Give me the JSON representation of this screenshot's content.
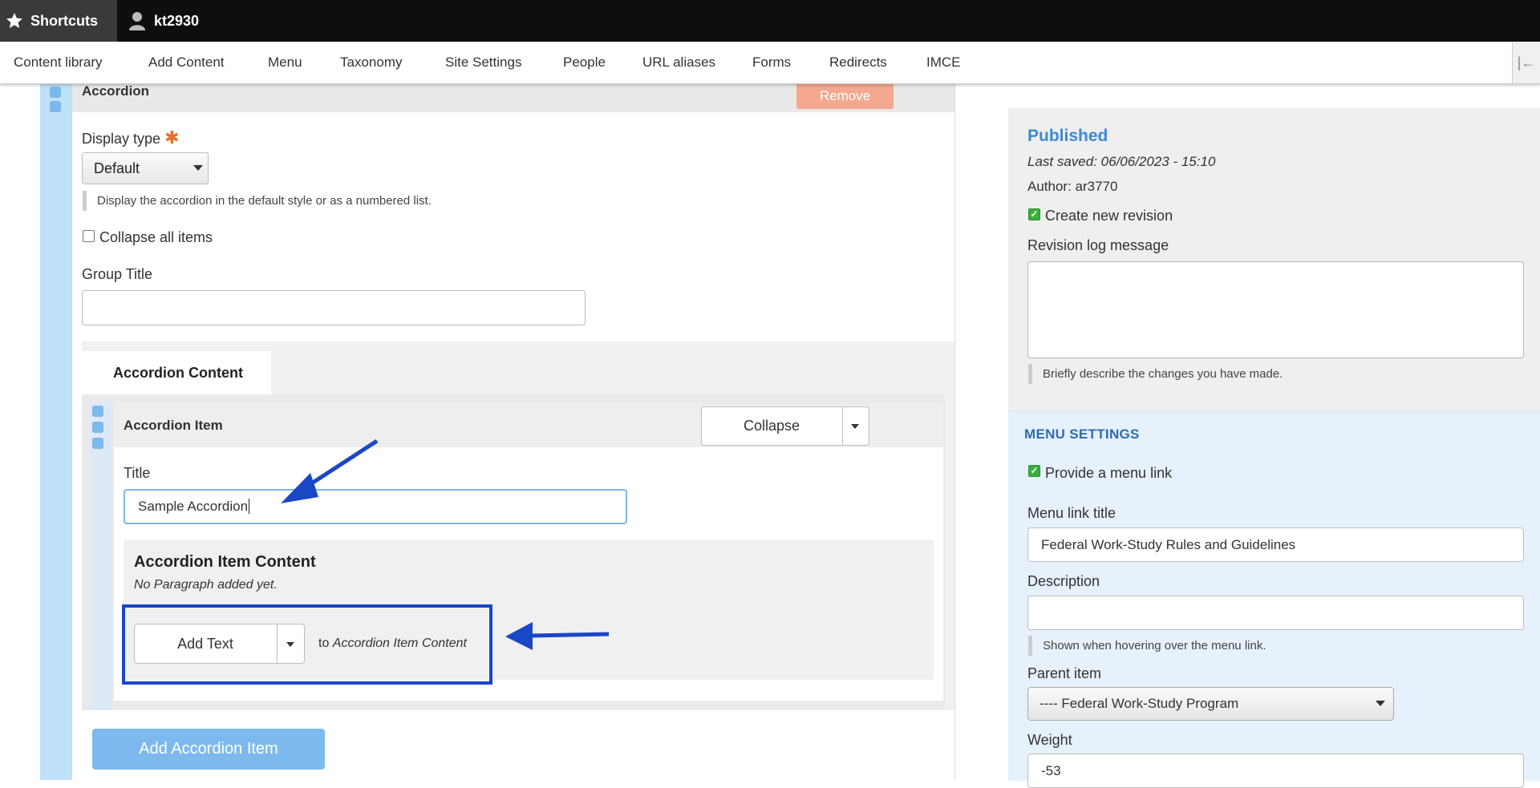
{
  "toolbar": {
    "shortcuts": "Shortcuts",
    "user": "kt2930"
  },
  "tray": {
    "items": [
      "Content library",
      "Add Content",
      "Menu",
      "Taxonomy",
      "Site Settings",
      "People",
      "URL aliases",
      "Forms",
      "Redirects",
      "IMCE"
    ]
  },
  "paragraph": {
    "title": "Accordion",
    "remove_label": "Remove",
    "display_type_label": "Display type",
    "display_type_value": "Default",
    "display_type_help": "Display the accordion in the default style or as a numbered list.",
    "collapse_all_label": "Collapse all items",
    "group_title_label": "Group Title",
    "group_title_value": "",
    "content_tab": "Accordion Content"
  },
  "accordion_item": {
    "title": "Accordion Item",
    "collapse_label": "Collapse",
    "title_label": "Title",
    "title_value": "Sample Accordion",
    "content_heading": "Accordion Item Content",
    "no_paragraph": "No Paragraph added yet.",
    "add_text_label": "Add Text",
    "to_prefix": "to",
    "to_target": "Accordion Item Content"
  },
  "add_accordion_item": "Add Accordion Item",
  "meta": {
    "status": "Published",
    "last_saved": "Last saved: 06/06/2023 - 15:10",
    "author": "Author: ar3770",
    "create_revision_label": "Create new revision",
    "create_revision_checked": true,
    "revision_log_label": "Revision log message",
    "revision_log_value": "",
    "revision_log_help": "Briefly describe the changes you have made."
  },
  "menu": {
    "heading": "MENU SETTINGS",
    "provide_link_label": "Provide a menu link",
    "provide_link_checked": true,
    "link_title_label": "Menu link title",
    "link_title_value": "Federal Work-Study Rules and Guidelines",
    "description_label": "Description",
    "description_value": "",
    "description_help": "Shown when hovering over the menu link.",
    "parent_label": "Parent item",
    "parent_value": "---- Federal Work-Study Program",
    "weight_label": "Weight",
    "weight_value": "-53"
  },
  "colors": {
    "annotation_arrow": "#1a47c5",
    "published": "#3b8ad6",
    "remove_button": "#f3a88f",
    "add_accordion_button": "#7db9ee"
  }
}
